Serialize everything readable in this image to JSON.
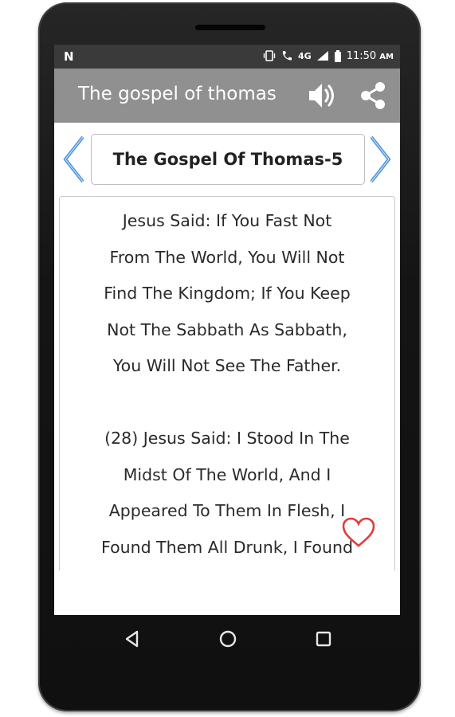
{
  "statusbar": {
    "carrier_icon": "N",
    "network": "4G",
    "time": "11:50",
    "ampm": "AM"
  },
  "appbar": {
    "title": "The gospel of thomas",
    "volume_icon": "volume-icon",
    "share_icon": "share-icon"
  },
  "chapter": {
    "title": "The Gospel Of Thomas-5"
  },
  "content": {
    "text": "Jesus Said: If You Fast Not\nFrom The World, You Will Not\nFind The Kingdom; If You Keep\nNot The Sabbath As Sabbath,\nYou Will Not See The Father.\n\n(28) Jesus Said: I Stood In The\nMidst Of The World, And I\nAppeared To Them In Flesh, I\nFound Them All Drunk, I Found"
  },
  "colors": {
    "appbar": "#909090",
    "statusbar": "#3a3a3a",
    "arrow": "#4a90d9",
    "heart": "#e23b3b"
  }
}
